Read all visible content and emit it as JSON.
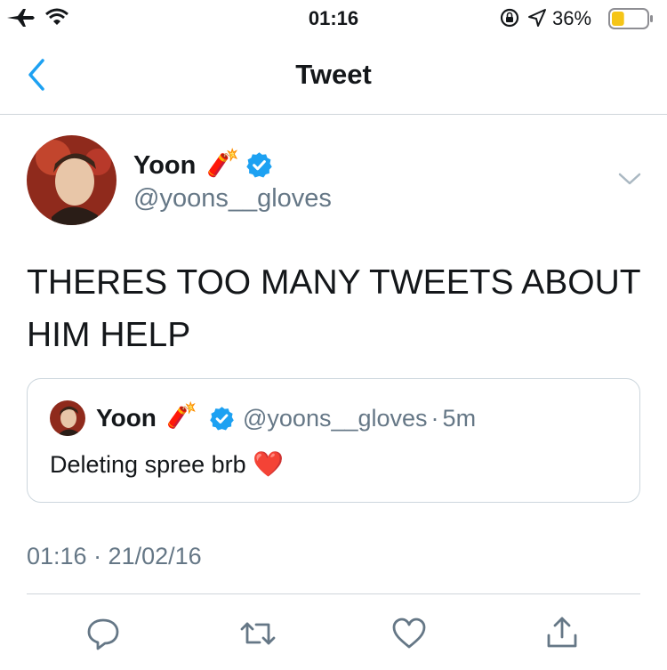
{
  "status_bar": {
    "time": "01:16",
    "battery": "36%",
    "battery_level": 0.36
  },
  "nav": {
    "title": "Tweet",
    "back_icon": "chevron-left-icon"
  },
  "tweet": {
    "author_name": "Yoon",
    "author_emoji": "🧨",
    "verified": true,
    "handle": "@yoons__gloves",
    "text": "THERES TOO MANY TWEETS ABOUT HIM HELP",
    "quoted": {
      "author_name": "Yoon",
      "author_emoji": "🧨",
      "verified": true,
      "handle": "@yoons__gloves",
      "separator": "·",
      "age": "5m",
      "text": "Deleting spree brb",
      "text_emoji": "❤️"
    },
    "timestamp": "01:16 · 21/02/16"
  },
  "actions": [
    "reply-icon",
    "retweet-icon",
    "like-icon",
    "share-icon"
  ],
  "colors": {
    "accent": "#1da1f2",
    "secondary_text": "#657786",
    "battery_fill": "#f5c518",
    "heart": "#d0021b"
  }
}
